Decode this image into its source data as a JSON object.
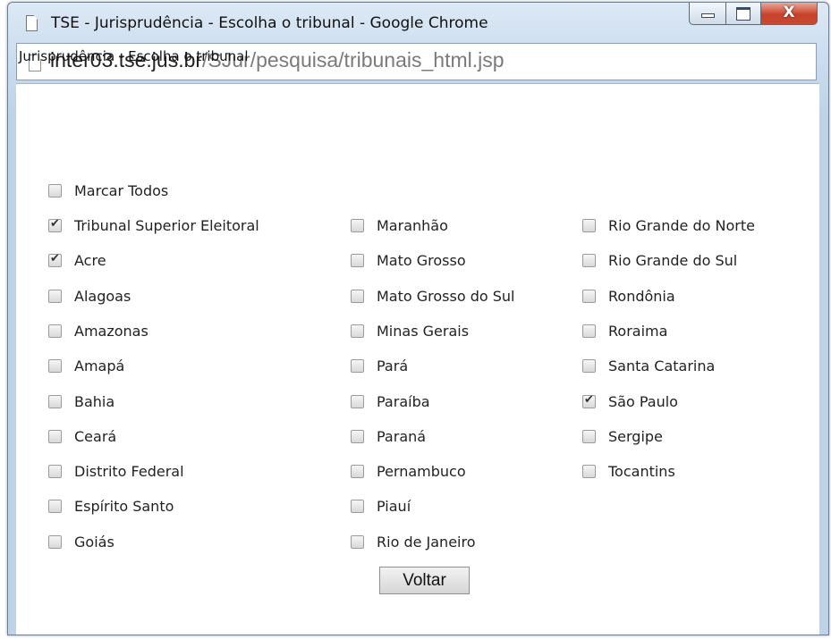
{
  "window": {
    "title": "TSE - Jurisprudência - Escolha o tribunal - Google Chrome",
    "close_symbol": "X"
  },
  "address": {
    "host": "inter03.tse.jus.br",
    "path": "/SJur/pesquisa/tribunais_html.jsp"
  },
  "page": {
    "heading": "Jurisprudência - Escolha o tribunal",
    "select_all": {
      "label": "Marcar Todos",
      "checked": false
    },
    "columns": [
      [
        {
          "label": "Tribunal Superior Eleitoral",
          "checked": true
        },
        {
          "label": "Acre",
          "checked": true
        },
        {
          "label": "Alagoas",
          "checked": false
        },
        {
          "label": "Amazonas",
          "checked": false
        },
        {
          "label": "Amapá",
          "checked": false
        },
        {
          "label": "Bahia",
          "checked": false
        },
        {
          "label": "Ceará",
          "checked": false
        },
        {
          "label": "Distrito Federal",
          "checked": false
        },
        {
          "label": "Espírito Santo",
          "checked": false
        },
        {
          "label": "Goiás",
          "checked": false
        }
      ],
      [
        {
          "label": "Maranhão",
          "checked": false
        },
        {
          "label": "Mato Grosso",
          "checked": false
        },
        {
          "label": "Mato Grosso do Sul",
          "checked": false
        },
        {
          "label": "Minas Gerais",
          "checked": false
        },
        {
          "label": "Pará",
          "checked": false
        },
        {
          "label": "Paraíba",
          "checked": false
        },
        {
          "label": "Paraná",
          "checked": false
        },
        {
          "label": "Pernambuco",
          "checked": false
        },
        {
          "label": "Piauí",
          "checked": false
        },
        {
          "label": "Rio de Janeiro",
          "checked": false
        }
      ],
      [
        {
          "label": "Rio Grande do Norte",
          "checked": false
        },
        {
          "label": "Rio Grande do Sul",
          "checked": false
        },
        {
          "label": "Rondônia",
          "checked": false
        },
        {
          "label": "Roraima",
          "checked": false
        },
        {
          "label": "Santa Catarina",
          "checked": false
        },
        {
          "label": "São Paulo",
          "checked": true
        },
        {
          "label": "Sergipe",
          "checked": false
        },
        {
          "label": "Tocantins",
          "checked": false
        }
      ]
    ],
    "back_button": "Voltar"
  }
}
